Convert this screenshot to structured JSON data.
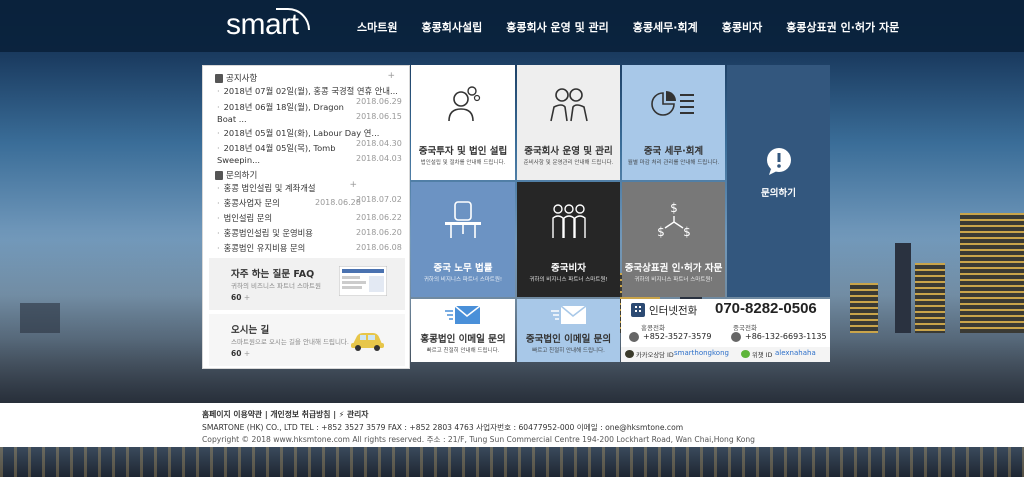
{
  "header": {
    "logo": "smart",
    "nav": [
      "스마트원",
      "홍콩회사설립",
      "홍콩회사 운영 및 관리",
      "홍콩세무·회계",
      "홍콩비자",
      "홍콩상표권 인·허가 자문"
    ]
  },
  "notice": {
    "title": "공지사항",
    "items": [
      {
        "text": "2018년 07월 02일(월), 홍콩 국경절 연휴 안내...",
        "date": "2018.06.29"
      },
      {
        "text": "2018년 06월 18일(월), Dragon Boat ...",
        "date": "2018.06.15"
      },
      {
        "text": "2018년 05월 01일(화), Labour Day 연...",
        "date": "2018.04.30"
      },
      {
        "text": "2018년 04월 05일(목), Tomb Sweepin...",
        "date": "2018.04.03"
      }
    ]
  },
  "inquiry": {
    "title": "문의하기",
    "items": [
      {
        "text": "홍콩 법인설립 및 계좌개설",
        "date": "2018.07.02"
      },
      {
        "text": "홍콩사업자 문의",
        "date": "2018.06.28"
      },
      {
        "text": "법인설립 문의",
        "date": "2018.06.22"
      },
      {
        "text": "홍콩법인설립 및 운영비용",
        "date": "2018.06.20"
      },
      {
        "text": "홍콩법인 유지비용 문의",
        "date": "2018.06.08"
      }
    ]
  },
  "faq": {
    "title": "자주 하는 질문 FAQ",
    "sub": "귀하의 비즈니스 파트너 스마트원",
    "num": "60"
  },
  "directions": {
    "title": "오시는 길",
    "sub": "스마트원으로 오시는 길을 안내해 드립니다.",
    "num": "60"
  },
  "tiles": [
    {
      "title": "중국투자 및 법인 설립",
      "sub": "법인설립 및 절차를 안내해 드립니다."
    },
    {
      "title": "중국회사 운영 및 관리",
      "sub": "준비사항 및 운영관리 안내해 드립니다."
    },
    {
      "title": "중국 세무·회계",
      "sub": "월별 마감 처리 관리를 안내해 드립니다."
    },
    {
      "title": "문의하기",
      "sub": ""
    },
    {
      "title": "중국 노무 법률",
      "sub": "귀하의 비지니스 파트너 스마트원!"
    },
    {
      "title": "중국비자",
      "sub": "귀하의 비지니스 파트너 스마트원!"
    },
    {
      "title": "중국상표권 인·허가 자문",
      "sub": "귀하의 비지니스 파트너 스마트원!"
    },
    {
      "title": "홍콩법인 이메일 문의",
      "sub": "빠르고 친절히 안내해 드립니다."
    },
    {
      "title": "중국법인 이메일 문의",
      "sub": "빠르고 친절히 안내해 드립니다."
    }
  ],
  "contact": {
    "label": "인터넷전화",
    "phone": "070-8282-0506",
    "hk_label": "홍콩전화",
    "hk_phone": "+852-3527-3579",
    "cn_label": "중국전화",
    "cn_phone": "+86-132-6693-1135",
    "kakao_label": "카카오상담 ID",
    "kakao_id": "smarthongkong",
    "wechat_label": "위챗 ID",
    "wechat_id": "alexnahaha"
  },
  "footer": {
    "links": "홈페이지 이용약관 | 개인정보 취급방침 | ⚡ 관리자",
    "company": "SMARTONE (HK) CO., LTD TEL : +852 3527 3579 FAX : +852 2803 4763 사업자번호 : 60477952-000 이메일 : one@hksmtone.com",
    "copyright": "Copyright © 2018 www.hksmtone.com All rights reserved. 주소 : 21/F, Tung Sun Commercial Centre 194-200 Lockhart Road, Wan Chai,Hong Kong"
  },
  "colors": {
    "header": "#0a223c",
    "tile_white": "#ffffff",
    "tile_grey": "#eeeeee",
    "tile_lightblue": "#a8c8e8",
    "tile_darkblue": "#33577e",
    "tile_midblue": "#6c93c3",
    "tile_black": "#262626",
    "tile_grey2": "#787878"
  }
}
